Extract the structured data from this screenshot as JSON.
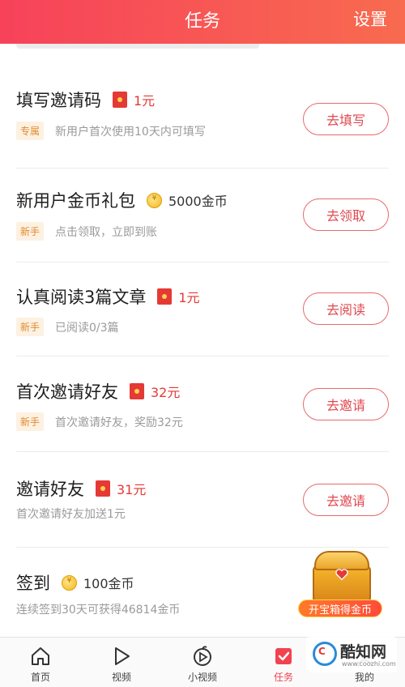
{
  "header": {
    "title": "任务",
    "settings": "设置"
  },
  "tasks": [
    {
      "title": "填写邀请码",
      "reward": "1元",
      "reward_type": "redpacket",
      "tag": "专属",
      "desc": "新用户首次使用10天内可填写",
      "button": "去填写"
    },
    {
      "title": "新用户金币礼包",
      "reward": "5000金币",
      "reward_type": "coin",
      "tag": "新手",
      "desc": "点击领取，立即到账",
      "button": "去领取"
    },
    {
      "title": "认真阅读3篇文章",
      "reward": "1元",
      "reward_type": "redpacket",
      "tag": "新手",
      "desc": "已阅读0/3篇",
      "button": "去阅读"
    },
    {
      "title": "首次邀请好友",
      "reward": "32元",
      "reward_type": "redpacket",
      "tag": "新手",
      "desc": "首次邀请好友，奖励32元",
      "button": "去邀请"
    },
    {
      "title": "邀请好友",
      "reward": "31元",
      "reward_type": "redpacket",
      "tag": "",
      "desc": "首次邀请好友加送1元",
      "button": "去邀请"
    },
    {
      "title": "签到",
      "reward": "100金币",
      "reward_type": "coin",
      "tag": "",
      "desc": "连续签到30天可获得46814金币",
      "button": ""
    }
  ],
  "treasure": {
    "label": "开宝箱得金币"
  },
  "tabbar": {
    "items": [
      {
        "label": "首页",
        "icon": "home-icon"
      },
      {
        "label": "视频",
        "icon": "play-icon"
      },
      {
        "label": "小视频",
        "icon": "small-video-icon"
      },
      {
        "label": "任务",
        "icon": "task-check-icon"
      },
      {
        "label": "我的",
        "icon": "profile-icon"
      }
    ],
    "active": "任务"
  },
  "watermark": {
    "logo": "C",
    "name": "酷知网",
    "url": "www.coozhi.com"
  },
  "colors": {
    "accent": "#f2424f",
    "header_start": "#f7425a",
    "header_end": "#f86b4f",
    "tag_bg": "#fdf1e2",
    "tag_text": "#e38a2c"
  }
}
